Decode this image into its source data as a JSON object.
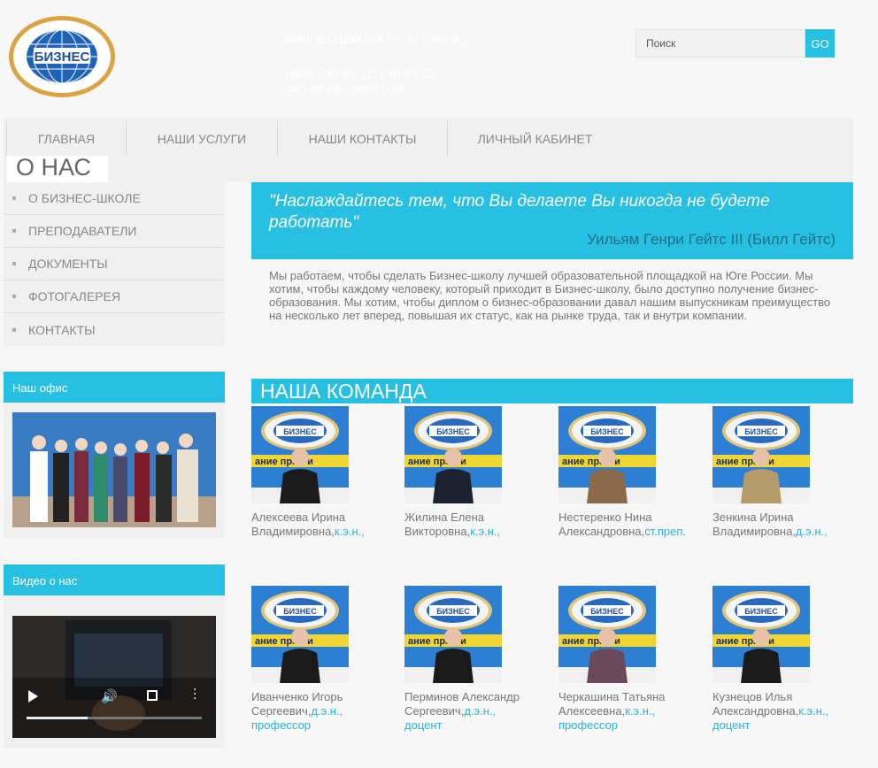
{
  "header": {
    "logo_text": "БИЗНЕС",
    "logo_ring_text": "РОСТОВСКИЙ ГОСУДАРСТВЕННЫЙ ЭКОНОМИЧЕСКИЙ УНИВЕРСИТЕТ (РИНХ)",
    "site_name": "БИЗНЕС-ШКОЛА РГЭУ (РИНХ)",
    "phone_line1": "(863) 240-97-11; 240-87-02",
    "phone_line2": "240-89-59; 240-11-19",
    "search_placeholder": "Поиск",
    "search_button": "GO"
  },
  "nav": {
    "items": [
      {
        "label": "ГЛАВНАЯ"
      },
      {
        "label": "НАШИ УСЛУГИ"
      },
      {
        "label": "НАШИ КОНТАКТЫ"
      },
      {
        "label": "ЛИЧНЫЙ КАБИНЕТ"
      }
    ]
  },
  "page_title": "О НАС",
  "sidebar": {
    "items": [
      {
        "label": "О БИЗНЕС-ШКОЛЕ"
      },
      {
        "label": "ПРЕПОДАВАТЕЛИ"
      },
      {
        "label": "ДОКУМЕНТЫ"
      },
      {
        "label": "ФОТОГАЛЕРЕЯ"
      },
      {
        "label": "КОНТАКТЫ"
      }
    ],
    "office_title": "Наш офис",
    "video_title": "Видео о нас"
  },
  "quote": {
    "text": "\"Наслаждайтесь тем, что Вы делаете Вы никогда не будете работать\"",
    "author": "Уильям Генри Гейтс III (Билл Гейтс)"
  },
  "intro": "Мы работаем, чтобы сделать Бизнес-школу лучшей образовательной площадкой на Юге России. Мы хотим, чтобы каждому человеку, который приходит в Бизнес-школу, было доступно получение бизнес-образования. Мы хотим, чтобы диплом о бизнес-образовании давал нашим выпускникам преимущество на несколько лет вперед, повышая их статус, как на рынке труда, так и внутри компании.",
  "team": {
    "title": "НАША КОМАНДА",
    "members": [
      {
        "line1": "Алексеева Ирина",
        "line2": "Владимировна,",
        "title1": "к.э.н.,",
        "title2": ""
      },
      {
        "line1": "Жилина Елена",
        "line2": "Викторовна,",
        "title1": "к.э.н.,",
        "title2": ""
      },
      {
        "line1": "Нестеренко Нина",
        "line2": "Александровна,",
        "title1": "ст.преп.",
        "title2": ""
      },
      {
        "line1": "Зенкина Ирина",
        "line2": "Владимировна,",
        "title1": "д.э.н.,",
        "title2": ""
      },
      {
        "line1": "Иванченко Игорь",
        "line2": "Сергеевич,",
        "title1": "д.э.н.,",
        "title2": "профессор"
      },
      {
        "line1": "Перминов Александр",
        "line2": "Сергеевич,",
        "title1": "д.э.н.,",
        "title2": "доцент"
      },
      {
        "line1": "Черкашина Татьяна",
        "line2": "Алексеевна,",
        "title1": "к.э.н.,",
        "title2": "профессор"
      },
      {
        "line1": "Кузнецов Илья",
        "line2": "Александровна,",
        "title1": "к.э.н.,",
        "title2": "доцент"
      }
    ],
    "photo_banner_text": "ание практи"
  },
  "video": {
    "progress": 0.35
  },
  "colors": {
    "accent": "#27c0e3",
    "nav_bg": "#f0f0f0",
    "link": "#27b6da"
  }
}
